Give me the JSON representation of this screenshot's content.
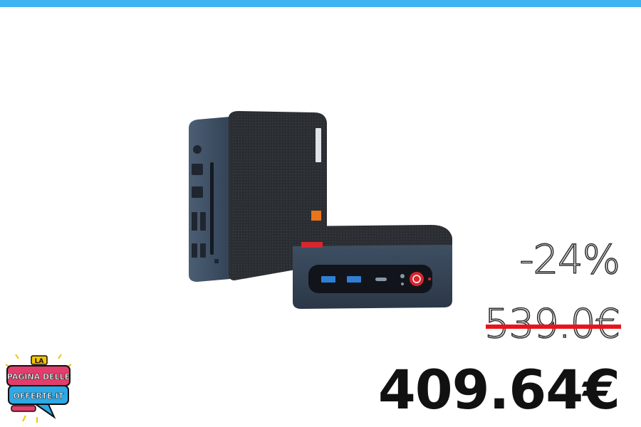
{
  "banner": {
    "accent_color": "#3fb4f0"
  },
  "product": {
    "image_icon": "mini-pc-product-image",
    "power_button_color": "#d8262e"
  },
  "pricing": {
    "discount": "-24%",
    "original_price": "539.0€",
    "current_price": "409.64€",
    "strike_color": "#e8141c"
  },
  "logo": {
    "line1": "LA",
    "line2": "PAGINA DELLE",
    "line3": "OFFERTE.IT",
    "primary_color": "#e23d6b",
    "secondary_color": "#2fa8e6"
  }
}
